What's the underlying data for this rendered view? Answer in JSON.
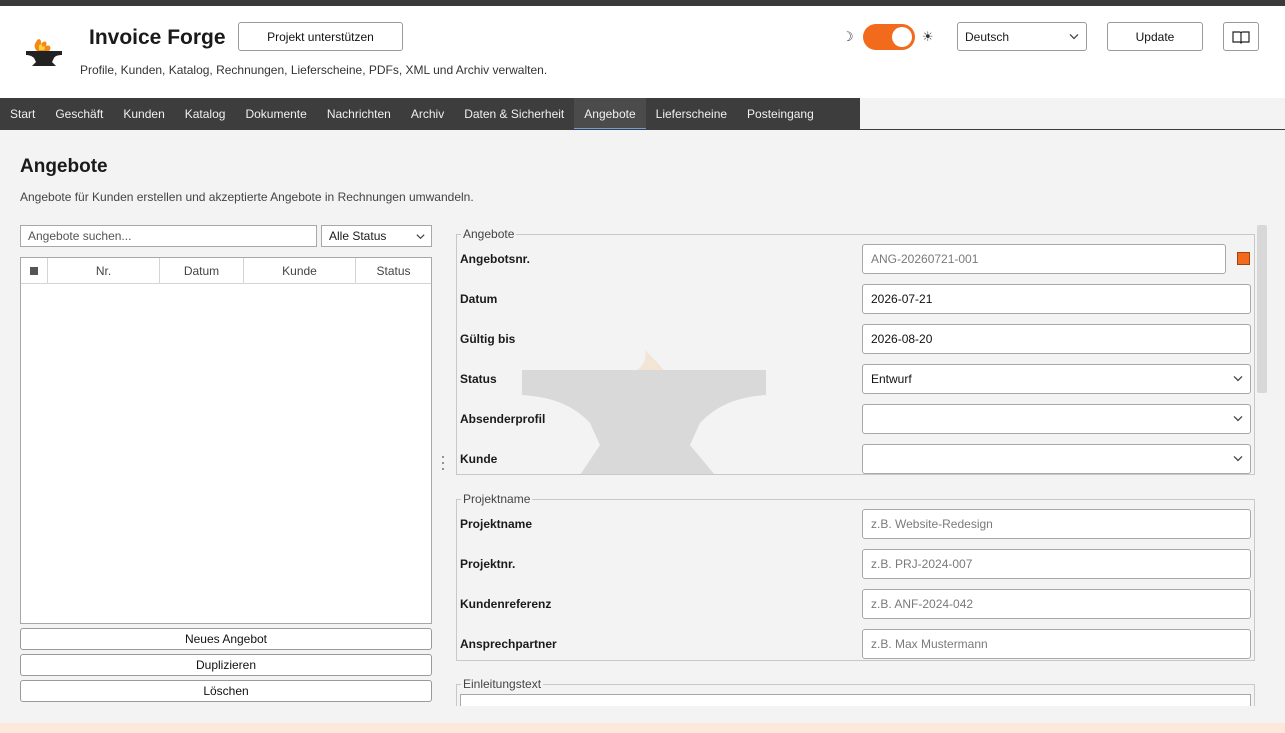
{
  "app": {
    "title": "Invoice Forge",
    "subtitle": "Profile, Kunden, Katalog, Rechnungen, Lieferscheine, PDFs, XML und Archiv verwalten.",
    "support_label": "Projekt unterstützen",
    "theme_toggle_on": true,
    "language": "Deutsch",
    "update_label": "Update",
    "accent_color": "#f26a1b"
  },
  "nav": {
    "tabs": [
      {
        "label": "Start"
      },
      {
        "label": "Geschäft"
      },
      {
        "label": "Kunden"
      },
      {
        "label": "Katalog"
      },
      {
        "label": "Dokumente"
      },
      {
        "label": "Nachrichten"
      },
      {
        "label": "Archiv"
      },
      {
        "label": "Daten & Sicherheit"
      },
      {
        "label": "Angebote"
      },
      {
        "label": "Lieferscheine"
      },
      {
        "label": "Posteingang"
      }
    ],
    "active": "Angebote"
  },
  "page": {
    "title": "Angebote",
    "subtitle": "Angebote für Kunden erstellen und akzeptierte Angebote in Rechnungen umwandeln."
  },
  "list": {
    "search_placeholder": "Angebote suchen...",
    "status_filter": "Alle Status",
    "columns": [
      "Nr.",
      "Datum",
      "Kunde",
      "Status"
    ],
    "rows": [],
    "buttons": {
      "new": "Neues Angebot",
      "duplicate": "Duplizieren",
      "delete": "Löschen"
    }
  },
  "form": {
    "offer_group": {
      "legend": "Angebote",
      "number_label": "Angebotsnr.",
      "number_value": "ANG-20260721-001",
      "date_label": "Datum",
      "date_value": "2026-07-21",
      "valid_label": "Gültig bis",
      "valid_value": "2026-08-20",
      "status_label": "Status",
      "status_value": "Entwurf",
      "sender_label": "Absenderprofil",
      "sender_value": "",
      "customer_label": "Kunde",
      "customer_value": ""
    },
    "project_group": {
      "legend": "Projektname",
      "name_label": "Projektname",
      "name_placeholder": "z.B. Website-Redesign",
      "number_label": "Projektnr.",
      "number_placeholder": "z.B. PRJ-2024-007",
      "ref_label": "Kundenreferenz",
      "ref_placeholder": "z.B. ANF-2024-042",
      "contact_label": "Ansprechpartner",
      "contact_placeholder": "z.B. Max Mustermann"
    },
    "intro_group": {
      "legend": "Einleitungstext"
    }
  }
}
